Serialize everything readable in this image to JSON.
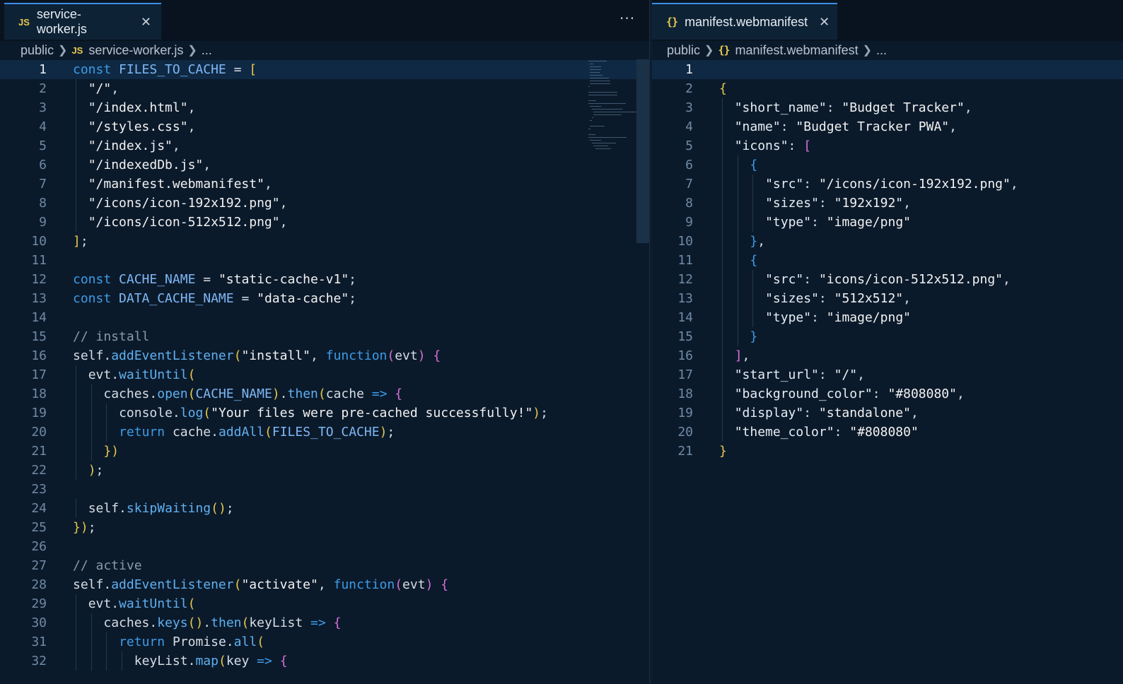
{
  "left_editor": {
    "tab": {
      "icon": "JS",
      "label": "service-worker.js"
    },
    "more_label": "···",
    "breadcrumb": {
      "folder": "public",
      "file_icon": "JS",
      "file": "service-worker.js",
      "ellipsis": "..."
    },
    "lines": [
      "const FILES_TO_CACHE = [",
      "  \"/\",",
      "  \"/index.html\",",
      "  \"/styles.css\",",
      "  \"/index.js\",",
      "  \"/indexedDb.js\",",
      "  \"/manifest.webmanifest\",",
      "  \"/icons/icon-192x192.png\",",
      "  \"/icons/icon-512x512.png\",",
      "];",
      "",
      "const CACHE_NAME = \"static-cache-v1\";",
      "const DATA_CACHE_NAME = \"data-cache\";",
      "",
      "// install",
      "self.addEventListener(\"install\", function(evt) {",
      "  evt.waitUntil(",
      "    caches.open(CACHE_NAME).then(cache => {",
      "      console.log(\"Your files were pre-cached successfully!\");",
      "      return cache.addAll(FILES_TO_CACHE);",
      "    })",
      "  );",
      "",
      "  self.skipWaiting();",
      "});",
      "",
      "// active",
      "self.addEventListener(\"activate\", function(evt) {",
      "  evt.waitUntil(",
      "    caches.keys().then(keyList => {",
      "      return Promise.all(",
      "        keyList.map(key => {"
    ]
  },
  "right_editor": {
    "tab": {
      "icon": "{}",
      "label": "manifest.webmanifest"
    },
    "breadcrumb": {
      "folder": "public",
      "file_icon": "{}",
      "file": "manifest.webmanifest",
      "ellipsis": "..."
    },
    "lines": [
      "",
      "{",
      "  \"short_name\": \"Budget Tracker\",",
      "  \"name\": \"Budget Tracker PWA\",",
      "  \"icons\": [",
      "    {",
      "      \"src\": \"/icons/icon-192x192.png\",",
      "      \"sizes\": \"192x192\",",
      "      \"type\": \"image/png\"",
      "    },",
      "    {",
      "      \"src\": \"icons/icon-512x512.png\",",
      "      \"sizes\": \"512x512\",",
      "      \"type\": \"image/png\"",
      "    }",
      "  ],",
      "  \"start_url\": \"/\",",
      "  \"background_color\": \"#808080\",",
      "  \"display\": \"standalone\",",
      "  \"theme_color\": \"#808080\"",
      "}"
    ]
  },
  "icons": {
    "close": "close-icon",
    "chevron": "chevron-right-icon",
    "more": "more-actions-icon"
  },
  "colors": {
    "background": "#0b1a2b",
    "tab_active_border": "#3b8eea",
    "keyword": "#3d9ce8",
    "string": "#f2f2f2",
    "comment": "#8a99a8",
    "bracket_yellow": "#e7c94c",
    "bracket_pink": "#d670d6"
  }
}
